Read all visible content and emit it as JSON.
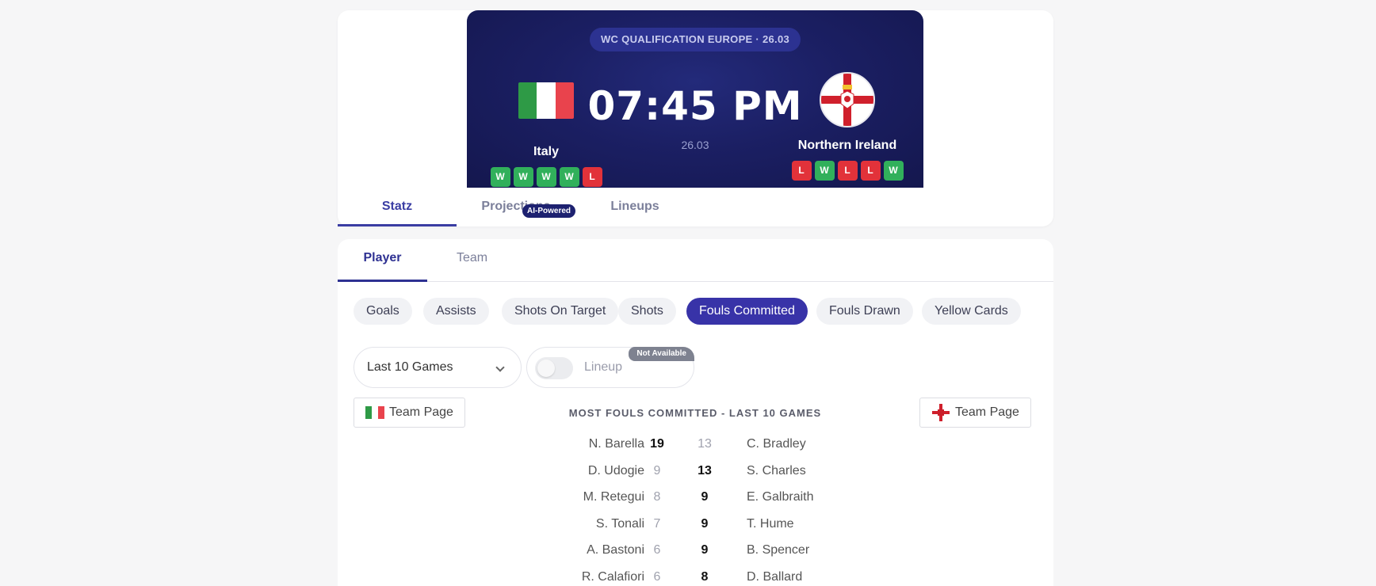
{
  "match": {
    "competition_badge": "WC QUALIFICATION EUROPE · 26.03",
    "time": "07:45 PM",
    "date": "26.03",
    "home": {
      "name": "Italy",
      "flag_colors": [
        "#2e9a46",
        "#ffffff",
        "#e9434d"
      ],
      "form": [
        "W",
        "W",
        "W",
        "W",
        "L"
      ]
    },
    "away": {
      "name": "Northern Ireland",
      "form": [
        "L",
        "W",
        "L",
        "L",
        "W"
      ]
    }
  },
  "main_tabs": [
    {
      "label": "Statz",
      "active": true
    },
    {
      "label": "Projections",
      "badge": "AI-Powered",
      "active": false
    },
    {
      "label": "Lineups",
      "active": false
    }
  ],
  "sub_tabs": [
    {
      "label": "Player",
      "active": true
    },
    {
      "label": "Team",
      "active": false
    }
  ],
  "stat_pills": [
    {
      "label": "Goals",
      "active": false
    },
    {
      "label": "Assists",
      "active": false
    },
    {
      "label": "Shots On Target",
      "active": false
    },
    {
      "label": "Shots",
      "active": false
    },
    {
      "label": "Fouls Committed",
      "active": true
    },
    {
      "label": "Fouls Drawn",
      "active": false
    },
    {
      "label": "Yellow Cards",
      "active": false
    }
  ],
  "filters": {
    "range_value": "Last 10 Games",
    "lineup_label": "Lineup",
    "lineup_badge": "Not Available"
  },
  "team_page_label": "Team Page",
  "stats_title": "MOST FOULS COMMITTED - LAST 10 GAMES",
  "rows": [
    {
      "home_player": "N. Barella",
      "home_value": "19",
      "away_value": "13",
      "away_player": "C. Bradley",
      "leader": "home"
    },
    {
      "home_player": "D. Udogie",
      "home_value": "9",
      "away_value": "13",
      "away_player": "S. Charles",
      "leader": "away"
    },
    {
      "home_player": "M. Retegui",
      "home_value": "8",
      "away_value": "9",
      "away_player": "E. Galbraith",
      "leader": "away"
    },
    {
      "home_player": "S. Tonali",
      "home_value": "7",
      "away_value": "9",
      "away_player": "T. Hume",
      "leader": "away"
    },
    {
      "home_player": "A. Bastoni",
      "home_value": "6",
      "away_value": "9",
      "away_player": "B. Spencer",
      "leader": "away"
    },
    {
      "home_player": "R. Calafiori",
      "home_value": "6",
      "away_value": "8",
      "away_player": "D. Ballard",
      "leader": "away"
    }
  ],
  "colors": {
    "accent": "#3833a8",
    "win": "#31b05b",
    "loss": "#e2323a",
    "hero_bg": "#1b1f63"
  }
}
